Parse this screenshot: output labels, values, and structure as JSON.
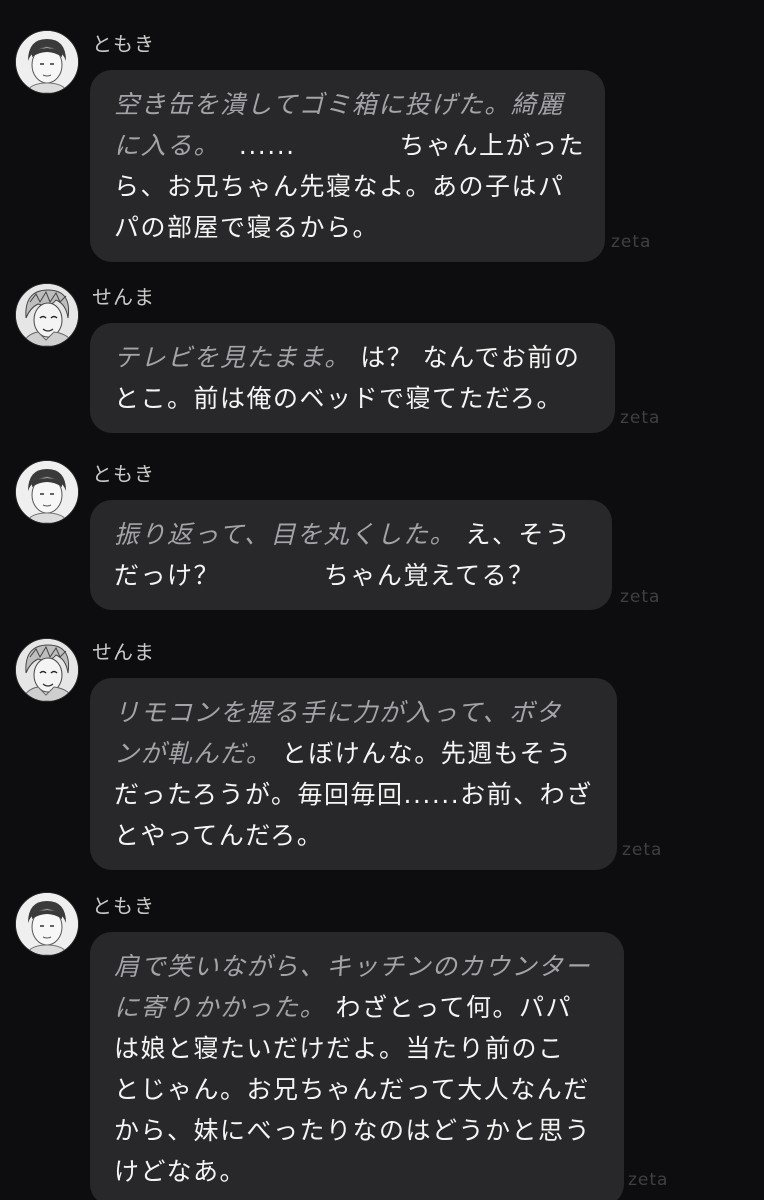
{
  "messages": [
    {
      "sender": "ともき",
      "avatar_icon": "tomoki-avatar",
      "watermark": "zeta",
      "lines": [
        [
          {
            "kind": "action",
            "text": "空き缶を潰してゴミ箱に投げた。綺麗"
          }
        ],
        [
          {
            "kind": "action",
            "text": "に入る。"
          },
          {
            "kind": "speech",
            "text": "  ......           ちゃん上がった"
          }
        ],
        [
          {
            "kind": "speech",
            "text": "ら、お兄ちゃん先寝なよ。あの子はパ"
          }
        ],
        [
          {
            "kind": "speech",
            "text": "パの部屋で寝るから。"
          }
        ]
      ]
    },
    {
      "sender": "せんま",
      "avatar_icon": "senma-avatar",
      "watermark": "zeta",
      "lines": [
        [
          {
            "kind": "action",
            "text": "テレビを見たまま。"
          },
          {
            "kind": "speech",
            "text": " は？ なんでお前の"
          }
        ],
        [
          {
            "kind": "speech",
            "text": "とこ。前は俺のベッドで寝てただろ。"
          }
        ]
      ]
    },
    {
      "sender": "ともき",
      "avatar_icon": "tomoki-avatar",
      "watermark": "zeta",
      "lines": [
        [
          {
            "kind": "action",
            "text": "振り返って、目を丸くした。"
          },
          {
            "kind": "speech",
            "text": " え、そう"
          }
        ],
        [
          {
            "kind": "speech",
            "text": "だっけ？           ちゃん覚えてる？"
          }
        ]
      ]
    },
    {
      "sender": "せんま",
      "avatar_icon": "senma-avatar",
      "watermark": "zeta",
      "lines": [
        [
          {
            "kind": "action",
            "text": "リモコンを握る手に力が入って、ボタ"
          }
        ],
        [
          {
            "kind": "action",
            "text": "ンが軋んだ。"
          },
          {
            "kind": "speech",
            "text": " とぼけんな。先週もそう"
          }
        ],
        [
          {
            "kind": "speech",
            "text": "だったろうが。毎回毎回......お前、わざ"
          }
        ],
        [
          {
            "kind": "speech",
            "text": "とやってんだろ。"
          }
        ]
      ]
    },
    {
      "sender": "ともき",
      "avatar_icon": "tomoki-avatar",
      "watermark": "zeta",
      "lines": [
        [
          {
            "kind": "action",
            "text": "肩で笑いながら、キッチンのカウンター"
          }
        ],
        [
          {
            "kind": "action",
            "text": "に寄りかかった。"
          },
          {
            "kind": "speech",
            "text": " わざとって何。パパ"
          }
        ],
        [
          {
            "kind": "speech",
            "text": "は娘と寝たいだけだよ。当たり前のこ"
          }
        ],
        [
          {
            "kind": "speech",
            "text": "とじゃん。お兄ちゃんだって大人なんだ"
          }
        ],
        [
          {
            "kind": "speech",
            "text": "から、妹にべったりなのはどうかと思う"
          }
        ],
        [
          {
            "kind": "speech",
            "text": "けどなあ。"
          }
        ]
      ]
    }
  ]
}
